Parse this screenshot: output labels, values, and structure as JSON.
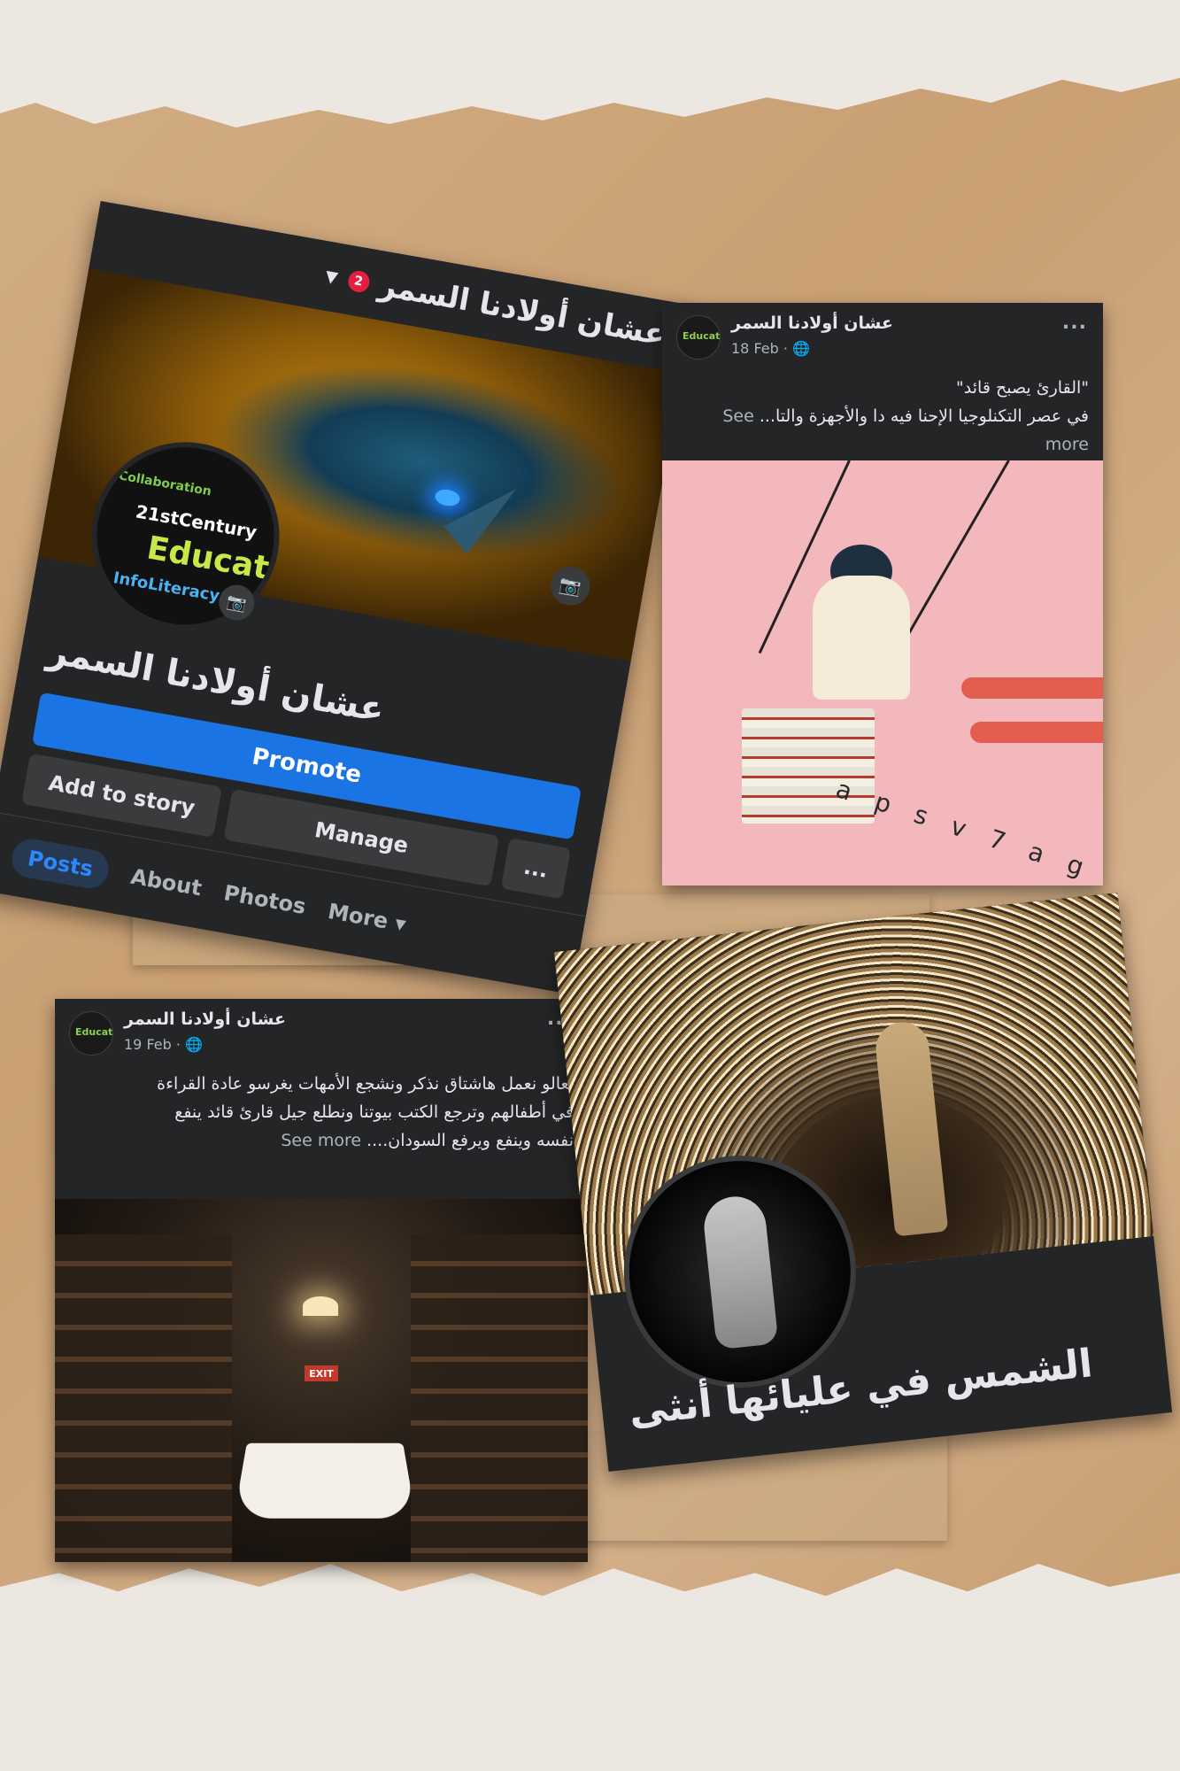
{
  "header_card": {
    "page_title": "عشان أولادنا السمر",
    "notification_count": "2",
    "page_name": "عشان أولادنا السمر",
    "promote_label": "Promote",
    "add_story_label": "Add to story",
    "manage_label": "Manage",
    "more_dots": "...",
    "avatar_words": [
      "Collaboration",
      "21stCentury",
      "Educat",
      "InfoLiteracy"
    ],
    "tabs": [
      {
        "label": "Posts"
      },
      {
        "label": "About"
      },
      {
        "label": "Photos"
      },
      {
        "label": "More ▾"
      }
    ]
  },
  "post1": {
    "author": "عشان أولادنا السمر",
    "date": "18 Feb · ",
    "avatar_text": "Educat",
    "dots": "...",
    "line1": "\"القارئ يصبح قائد\"",
    "line2": "في عصر التكنلوجيا الإحنا فيه دا والأجهزة والتا...",
    "see_more": "See more",
    "image_letters": "a p s v 7 a g"
  },
  "post2": {
    "author": "عشان أولادنا السمر",
    "date": "19 Feb · ",
    "avatar_text": "Educat",
    "dots": "...",
    "line1": "تعالو نعمل هاشتاق نذكر ونشجع الأمهات يغرسو عادة القراءة",
    "line2": "في أطفالهم وترجع الكتب بيوتنا ونطلع جيل قارئ قائد ينفع",
    "line3": "نفسه وينفع ويرفع السودان....",
    "see_more": "See more",
    "exit_sign": "EXIT"
  },
  "profile_card": {
    "title": "الشمس في عليائها أنثى"
  },
  "colors": {
    "facebook_blue": "#1b74e4",
    "card_bg": "#242526",
    "badge_red": "#e41e3f"
  }
}
